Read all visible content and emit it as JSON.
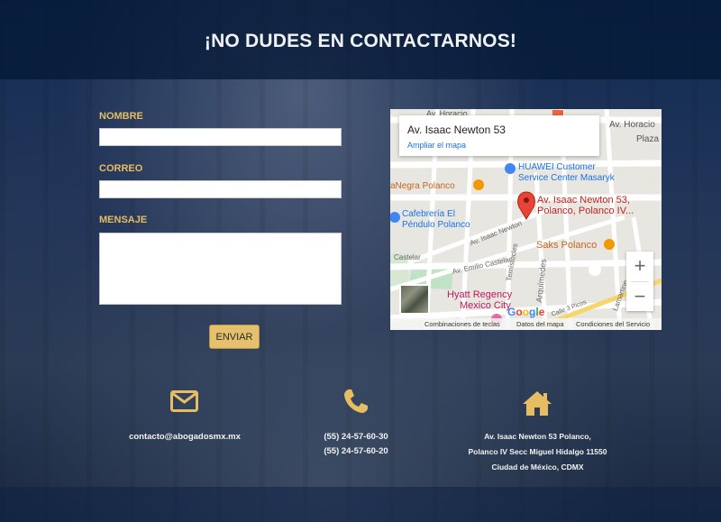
{
  "header": {
    "title": "¡NO DUDES EN CONTACTARNOS!"
  },
  "form": {
    "name_label": "NOMBRE",
    "name_value": "",
    "email_label": "CORREO",
    "email_value": "",
    "message_label": "MENSAJE",
    "message_value": "",
    "submit_label": "ENVIAR"
  },
  "map": {
    "info_title": "Av. Isaac Newton 53",
    "info_link": "Ampliar el mapa",
    "marker_label_1": "Av. Isaac Newton 53,",
    "marker_label_2": "Polanco, Polanco IV...",
    "places": {
      "huawei_1": "HUAWEI Customer",
      "huawei_2": "Service Center Masaryk",
      "sanegra": "aNegra Polanco",
      "cafeteria_1": "Cafebrería El",
      "cafeteria_2": "Péndulo Polanco",
      "saks": "Saks Polanco",
      "hyatt_1": "Hyatt Regency",
      "hyatt_2": "Mexico City",
      "plaza": "Plaza"
    },
    "streets": {
      "horacio_1": "Av. Horacio",
      "horacio_2": "Av. Horacio",
      "newton": "Av. Isaac Newton",
      "castelar": "Av. Emilio Castelar",
      "castelar_short": "Castelar",
      "temistocles": "Temístocles",
      "arquimedes": "Arquímedes",
      "lamartine": "Lamartine",
      "calle3picos": "Calle 3 Picos"
    },
    "zoom_in": "+",
    "zoom_out": "−",
    "google": "Google",
    "attribution": {
      "shortcuts": "Combinaciones de teclas",
      "data": "Datos del mapa",
      "terms": "Condiciones del Servicio"
    }
  },
  "contact": {
    "email": "contacto@abogadosmx.mx",
    "phone_1": "(55) 24-57-60-30",
    "phone_2": "(55) 24-57-60-20",
    "address_1": "Av. Isaac Newton 53 Polanco,",
    "address_2": "Polanco IV Secc Miguel Hidalgo 11550",
    "address_3": "Ciudad de México, CDMX"
  },
  "colors": {
    "accent": "#e6bd62",
    "button": "#e5c16e",
    "header_band": "#05193a",
    "text_light": "#f1f2f4"
  },
  "icons": {
    "email": "envelope-icon",
    "phone": "phone-icon",
    "address": "house-icon",
    "map_marker": "map-pin-icon"
  }
}
